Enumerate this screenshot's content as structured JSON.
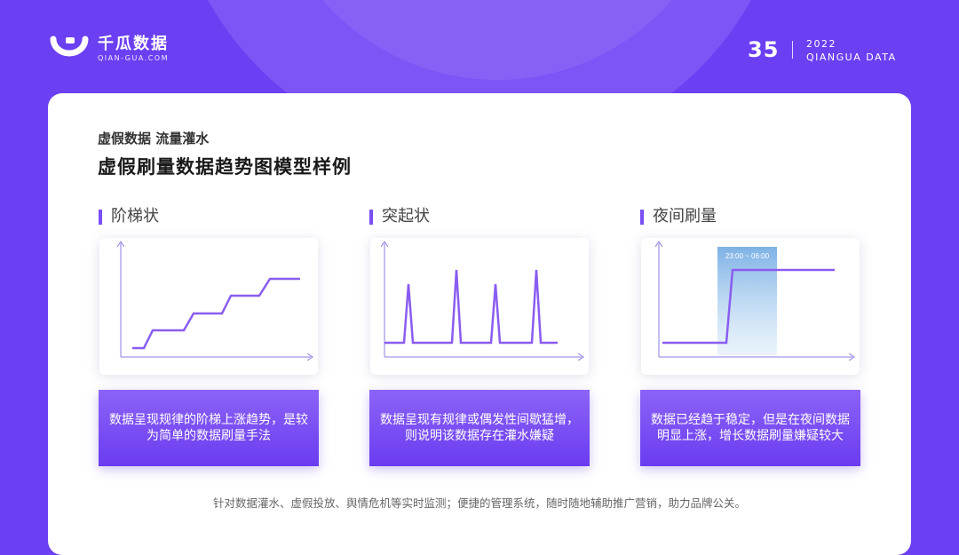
{
  "brand": {
    "name": "千瓜数据",
    "url": "QIAN-GUA.COM",
    "color": "#6b3ff2"
  },
  "header": {
    "page_number": "35",
    "year": "2022",
    "company": "QIANGUA DATA"
  },
  "card": {
    "subtitle": "虚假数据 流量灌水",
    "title": "虚假刷量数据趋势图模型样例",
    "sections": [
      {
        "title": "阶梯状",
        "chart_type": "step-line",
        "description": "数据呈现规律的阶梯上涨趋势，是较为简单的数据刷量手法"
      },
      {
        "title": "突起状",
        "chart_type": "spike-line",
        "description": "数据呈现有规律或偶发性间歇猛增，则说明该数据存在灌水嫌疑"
      },
      {
        "title": "夜间刷量",
        "chart_type": "night-jump-line",
        "time_window_label": "23:00 ~ 06:00",
        "description": "数据已经趋于稳定，但是在夜间数据明显上涨，增长数据刷量嫌疑较大"
      }
    ],
    "footer": "针对数据灌水、虚假投放、舆情危机等实时监测；便捷的管理系统，随时随地辅助推广营销，助力品牌公关。"
  },
  "colors": {
    "accent": "#7a4ef5",
    "line": "#8a5cf0",
    "night_band": "#7fb6e6"
  }
}
